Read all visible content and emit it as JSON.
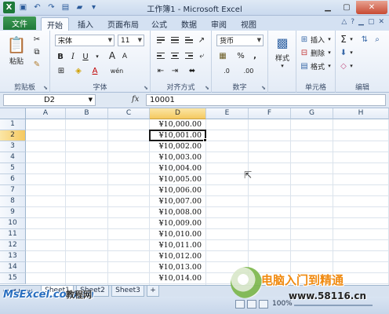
{
  "window": {
    "title": "工作簿1 - Microsoft Excel",
    "app_icon": "X"
  },
  "tabs": {
    "file": "文件",
    "items": [
      "开始",
      "插入",
      "页面布局",
      "公式",
      "数据",
      "审阅",
      "视图"
    ]
  },
  "ribbon": {
    "clipboard": {
      "label": "剪贴板",
      "paste": "粘贴"
    },
    "font": {
      "label": "字体",
      "name": "宋体",
      "size": "11",
      "bold": "B",
      "italic": "I",
      "underline": "U",
      "grow": "A",
      "shrink": "A",
      "font_color": "A",
      "wen": "wén"
    },
    "alignment": {
      "label": "对齐方式"
    },
    "number": {
      "label": "数字",
      "format": "货币",
      "percent": "%",
      "comma": ",",
      "inc": ".0",
      "dec": ".00"
    },
    "styles": {
      "label": "样式"
    },
    "cells": {
      "label": "单元格",
      "insert": "插入",
      "delete": "删除",
      "format": "格式"
    },
    "editing": {
      "label": "编辑",
      "sum": "Σ"
    }
  },
  "formula_bar": {
    "name_box": "D2",
    "fx": "fx",
    "value": "10001"
  },
  "grid": {
    "columns": [
      "A",
      "B",
      "C",
      "D",
      "E",
      "F",
      "G",
      "H"
    ],
    "rows": [
      "1",
      "2",
      "3",
      "4",
      "5",
      "6",
      "7",
      "8",
      "9",
      "10",
      "11",
      "12",
      "13",
      "14",
      "15"
    ],
    "d_values": [
      "¥10,000.00",
      "¥10,001.00",
      "¥10,002.00",
      "¥10,003.00",
      "¥10,004.00",
      "¥10,005.00",
      "¥10,006.00",
      "¥10,007.00",
      "¥10,008.00",
      "¥10,009.00",
      "¥10,010.00",
      "¥10,011.00",
      "¥10,012.00",
      "¥10,013.00",
      "¥10,014.00"
    ],
    "active_cell": "D2"
  },
  "sheets": [
    "Sheet1",
    "Sheet2",
    "Sheet3"
  ],
  "status": {
    "zoom": "100%"
  },
  "watermarks": {
    "logo": "MsExcel.com.cn",
    "cn": "教程网",
    "brand": "电脑入门到精通",
    "url": "www.58116.cn"
  }
}
